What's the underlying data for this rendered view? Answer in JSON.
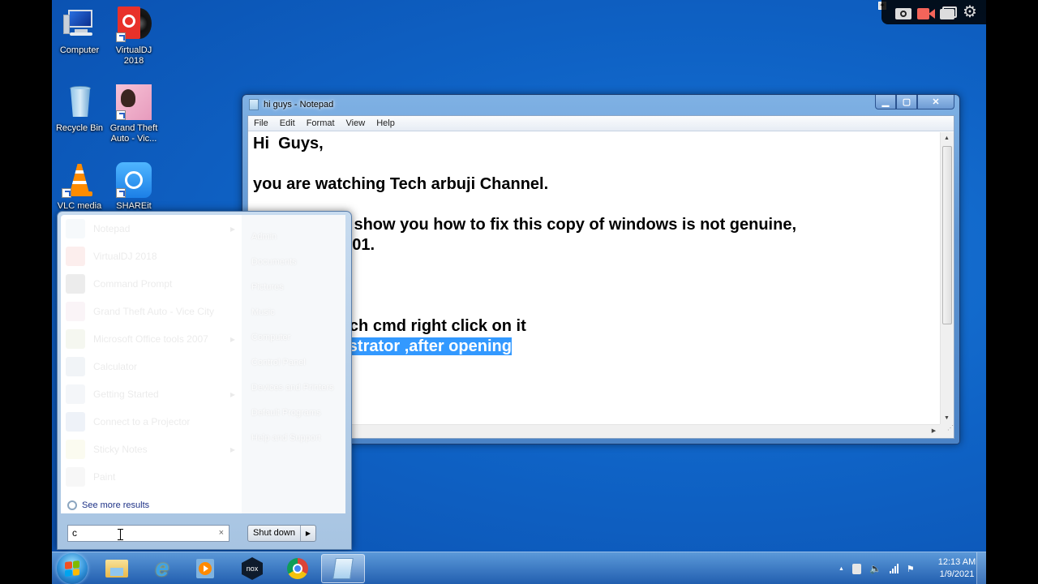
{
  "desktop": {
    "icons": [
      {
        "label": "Computer",
        "icon": "computer-icon"
      },
      {
        "label": "VirtualDJ 2018",
        "icon": "virtualdj-icon"
      },
      {
        "label": "Recycle Bin",
        "icon": "recycle-bin-icon"
      },
      {
        "label": "Grand Theft Auto - Vic...",
        "icon": "gta-icon"
      },
      {
        "label": "VLC media",
        "icon": "vlc-icon"
      },
      {
        "label": "SHAREit",
        "icon": "shareit-icon"
      }
    ]
  },
  "capture_toolbar": {
    "items": [
      "pin-icon",
      "camera-icon",
      "record-video-icon",
      "gallery-icon",
      "settings-gear-icon"
    ],
    "record_color": "#f4645a"
  },
  "notepad": {
    "title": "hi guys - Notepad",
    "menu": [
      "File",
      "Edit",
      "Format",
      "View",
      "Help"
    ],
    "controls": {
      "minimize": "▁",
      "maximize": "▢",
      "close": "✕"
    },
    "lines": [
      {
        "text": "Hi  Guys,"
      },
      {
        "text": ""
      },
      {
        "text": "you are watching Tech arbuji Channel."
      },
      {
        "text": ""
      },
      {
        "text": "                  to show you how to fix this copy of windows is not genuine,"
      },
      {
        "text": "                  7601."
      },
      {
        "text": ""
      },
      {
        "text": ""
      },
      {
        "text": ""
      },
      {
        "text": "                  arch cmd right click on it"
      },
      {
        "text_before": "                  ",
        "text_selected": "nistrator ,after opening"
      }
    ],
    "selection_color": "#3399ff"
  },
  "start_menu": {
    "programs": [
      {
        "label": "Notepad",
        "has_submenu": true,
        "color": "#9cb8d8"
      },
      {
        "label": "VirtualDJ 2018",
        "has_submenu": false,
        "color": "#e33a2e"
      },
      {
        "label": "Command Prompt",
        "has_submenu": false,
        "color": "#222222"
      },
      {
        "label": "Grand Theft Auto - Vice City",
        "has_submenu": false,
        "color": "#c97aa0"
      },
      {
        "label": "Microsoft Office tools 2007",
        "has_submenu": true,
        "color": "#8aa04a"
      },
      {
        "label": "Calculator",
        "has_submenu": false,
        "color": "#5e7fa8"
      },
      {
        "label": "Getting Started",
        "has_submenu": true,
        "color": "#7c97b7"
      },
      {
        "label": "Connect to a Projector",
        "has_submenu": false,
        "color": "#3468b4"
      },
      {
        "label": "Sticky Notes",
        "has_submenu": true,
        "color": "#d8d24a"
      },
      {
        "label": "Paint",
        "has_submenu": false,
        "color": "#a0a0a0"
      }
    ],
    "right_items": [
      "Admin",
      "Documents",
      "Pictures",
      "Music",
      "Computer",
      "Control Panel",
      "Devices and Printers",
      "Default Programs",
      "Help and Support"
    ],
    "see_more": "See more results",
    "search_value": "c",
    "search_clear": "×",
    "shutdown_label": "Shut down",
    "shutdown_arrow": "▶"
  },
  "taskbar": {
    "pinned": [
      {
        "name": "windows-explorer",
        "icon": "folder-icon"
      },
      {
        "name": "internet-explorer",
        "icon": "ie-icon"
      },
      {
        "name": "media-player",
        "icon": "media-player-icon"
      },
      {
        "name": "nox",
        "icon": "nox-icon",
        "label": "nox"
      },
      {
        "name": "chrome",
        "icon": "chrome-icon"
      },
      {
        "name": "notepad",
        "icon": "notepad-icon",
        "active": true
      }
    ],
    "tray": {
      "show_hidden": "▲",
      "time": "12:13 AM",
      "date": "1/9/2021"
    }
  }
}
